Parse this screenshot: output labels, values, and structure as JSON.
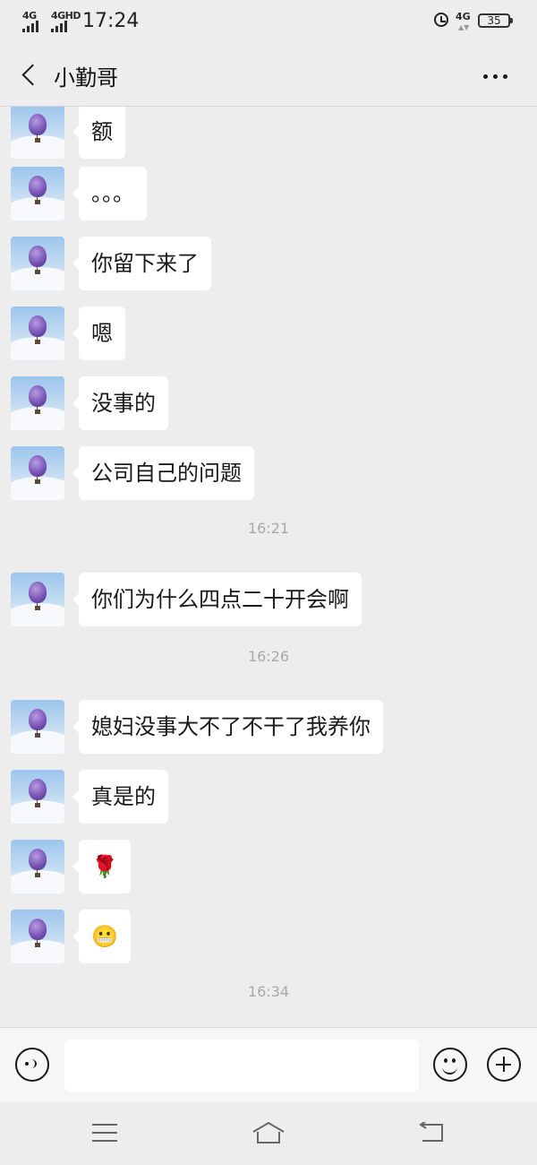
{
  "status_bar": {
    "signal_1": "4G",
    "signal_2": "4GHD",
    "time": "17:24",
    "network": "4G",
    "battery": "35"
  },
  "header": {
    "title": "小勤哥"
  },
  "messages": [
    {
      "type": "msg",
      "text": "额"
    },
    {
      "type": "msg",
      "text": "。。。"
    },
    {
      "type": "msg",
      "text": "你留下来了"
    },
    {
      "type": "msg",
      "text": "嗯"
    },
    {
      "type": "msg",
      "text": "没事的"
    },
    {
      "type": "msg",
      "text": "公司自己的问题"
    },
    {
      "type": "time",
      "text": "16:21"
    },
    {
      "type": "msg",
      "text": "你们为什么四点二十开会啊"
    },
    {
      "type": "time",
      "text": "16:26"
    },
    {
      "type": "msg",
      "text": "媳妇没事大不了不干了我养你"
    },
    {
      "type": "msg",
      "text": "真是的"
    },
    {
      "type": "msg",
      "text": "🌹"
    },
    {
      "type": "msg",
      "text": "😬"
    },
    {
      "type": "time",
      "text": "16:34"
    }
  ],
  "input": {
    "value": ""
  },
  "icons": {
    "back": "chevron-left-icon",
    "more": "more-dots-icon",
    "voice": "voice-icon",
    "emoji": "emoji-icon",
    "plus": "plus-icon",
    "nav_menu": "menu-icon",
    "nav_home": "home-icon",
    "nav_back": "back-icon"
  }
}
